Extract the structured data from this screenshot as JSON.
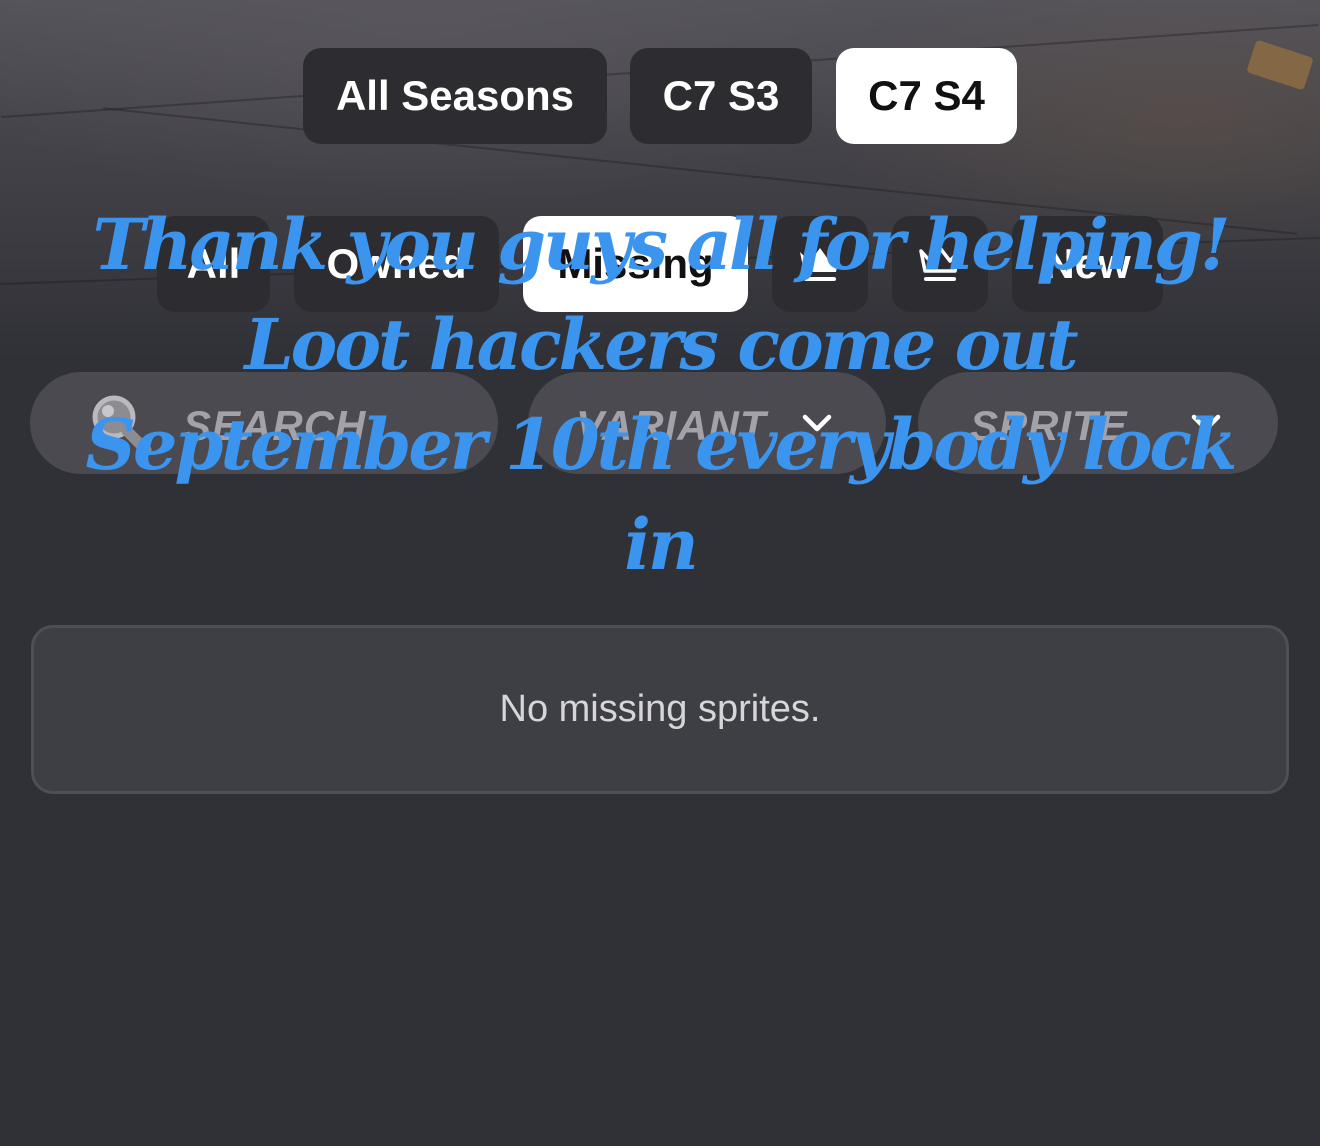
{
  "season_tabs": [
    {
      "label": "All Seasons",
      "active": false
    },
    {
      "label": "C7 S3",
      "active": false
    },
    {
      "label": "C7 S4",
      "active": true
    }
  ],
  "filter_tabs": {
    "all": "All",
    "owned": "Owned",
    "missing": "Missing",
    "crown_filled_icon": "crown-filled-icon",
    "crown_outline_icon": "crown-outline-icon",
    "new": "New",
    "active": "Missing"
  },
  "search": {
    "placeholder": "SEARCH",
    "icon": "search-icon"
  },
  "dropdowns": {
    "variant": "VARIANT",
    "sprite": "SPRITE"
  },
  "empty_message": "No missing sprites.",
  "overlay_caption": "Thank you guys all for helping! Loot hackers come out September 10th everybody lock in",
  "colors": {
    "background": "#303136",
    "pill": "#2d2d31",
    "pill_active": "#ffffff",
    "dropdown": "#4a4a50",
    "caption": "#3b95ee"
  }
}
